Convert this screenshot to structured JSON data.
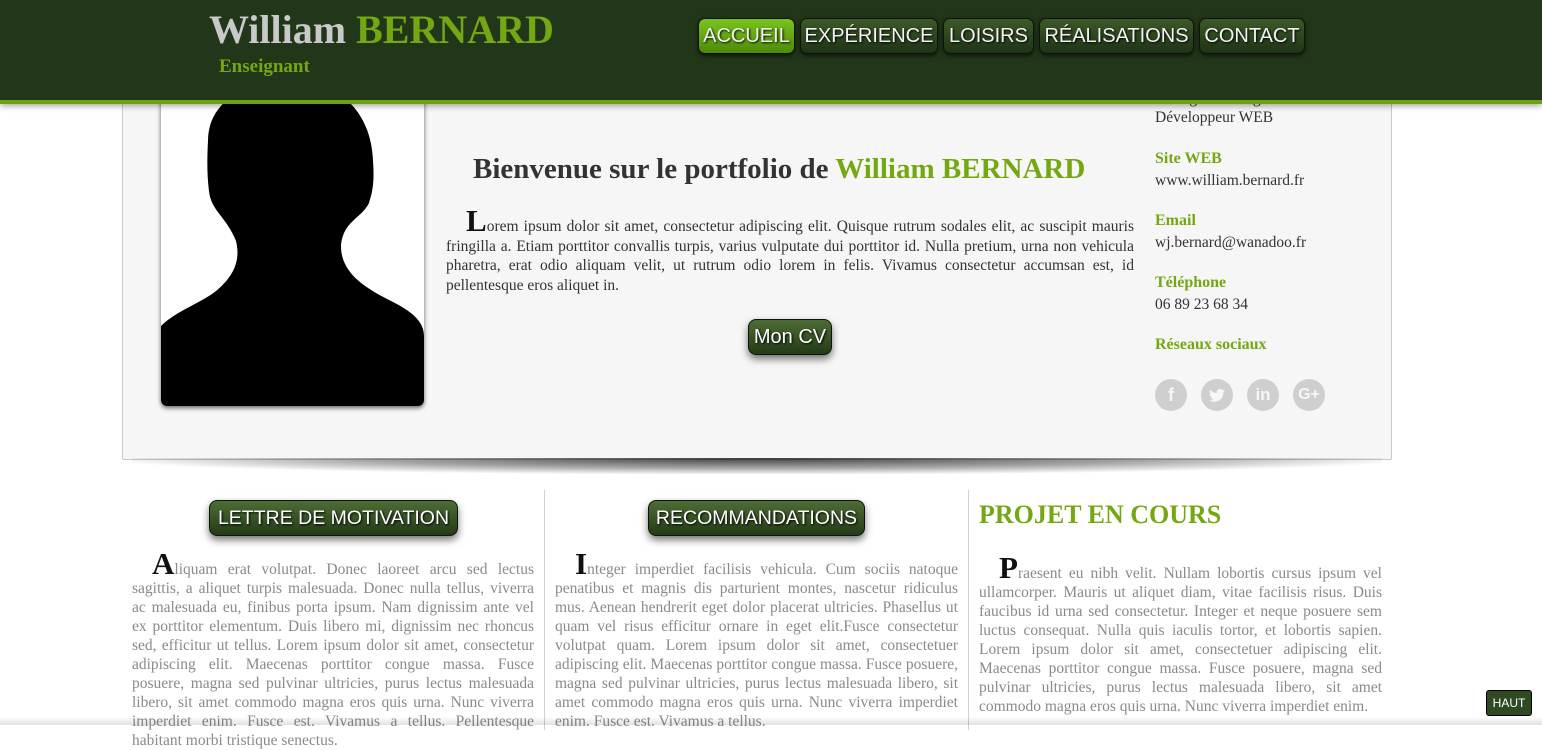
{
  "header": {
    "first_name": "William",
    "last_name": "BERNARD",
    "subtitle": "Enseignant",
    "nav": [
      "ACCUEIL",
      "EXPÉRIENCE",
      "LOISIRS",
      "RÉALISATIONS",
      "CONTACT"
    ],
    "active_nav": "ACCUEIL"
  },
  "hero": {
    "welcome_prefix": "Bienvenue sur le portfolio de",
    "welcome_name": "William BERNARD",
    "intro_dropcap": "L",
    "intro_text": "orem ipsum dolor sit amet, consectetur adipiscing elit. Quisque rutrum sodales elit, ac suscipit mauris fringilla a. Etiam porttitor convallis turpis, varius vulputate dui porttitor id. Nulla pretium, urna non vehicula pharetra, erat odio aliquam velit, ut rutrum odio lorem in felis. Vivamus consectetur accumsan est, id pellentesque eros aliquet in.",
    "cv_button": "Mon CV"
  },
  "info": {
    "roles": [
      "Enseignant d'anglais",
      "Développeur WEB"
    ],
    "site_title": "Site WEB",
    "site": "www.william.bernard.fr",
    "email_title": "Email",
    "email": "wj.bernard@wanadoo.fr",
    "phone_title": "Téléphone",
    "phone": "06 89 23 68 34",
    "social_title": "Réseaux sociaux",
    "social_icons": [
      "facebook-icon",
      "twitter-icon",
      "linkedin-icon",
      "google-plus-icon"
    ]
  },
  "columns": {
    "motivation": {
      "button": "LETTRE DE MOTIVATION",
      "dropcap": "A",
      "text": "liquam erat volutpat. Donec laoreet arcu sed lectus sagittis, a aliquet turpis malesuada. Donec nulla tellus, viverra ac malesuada eu, finibus porta ipsum. Nam dignissim ante vel ex porttitor elementum. Duis libero mi, dignissim nec rhoncus sed, efficitur ut tellus. Lorem ipsum dolor sit amet, consectetur adipiscing elit. Maecenas porttitor congue massa. Fusce posuere, magna sed pulvinar ultricies, purus lectus malesuada libero, sit amet commodo magna eros quis urna. Nunc viverra imperdiet enim. Fusce est. Vivamus a tellus. Pellentesque habitant morbi tristique senectus."
    },
    "recommandations": {
      "button": "RECOMMANDATIONS",
      "dropcap": "I",
      "text": "nteger imperdiet facilisis vehicula. Cum sociis natoque penatibus et magnis dis parturient montes, nascetur ridiculus mus. Aenean hendrerit eget dolor placerat ultricies. Phasellus ut quam vel risus efficitur ornare in eget elit.Fusce consectetur volutpat quam. Lorem ipsum dolor sit amet, consectetuer adipiscing elit. Maecenas porttitor congue massa. Fusce posuere, magna sed pulvinar ultricies, purus lectus malesuada libero, sit amet commodo magna eros quis urna. Nunc viverra imperdiet enim. Fusce est. Vivamus a tellus."
    },
    "projet": {
      "title": "PROJET EN COURS",
      "dropcap": "P",
      "text": "raesent eu nibh velit. Nullam lobortis cursus ipsum vel ullamcorper. Mauris ut aliquet diam, vitae facilisis risus. Duis faucibus id urna sed consectetur. Integer et neque posuere sem luctus consequat. Nulla quis iaculis tortor, et lobortis sapien. Lorem ipsum dolor sit amet, consectetuer adipiscing elit. Maecenas porttitor congue massa. Fusce posuere, magna sed pulvinar ultricies, purus lectus malesuada libero, sit amet commodo magna eros quis urna. Nunc viverra imperdiet enim."
    }
  },
  "top_button": "HAUT",
  "colors": {
    "header_bg": "#22361a",
    "accent": "#74a812",
    "button": "#2f4a22"
  }
}
